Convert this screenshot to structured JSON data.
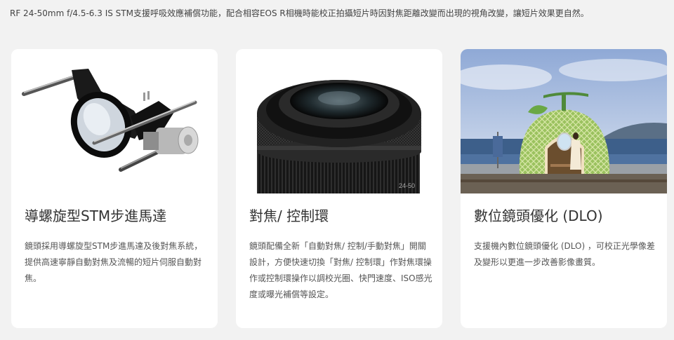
{
  "intro": "RF 24-50mm f/4.5-6.3 IS STM支援呼吸效應補償功能，配合相容EOS R相機時能校正拍攝短片時因對焦距離改變而出現的視角改變，讓短片效果更自然。",
  "cards": [
    {
      "title": "導螺旋型STM步進馬達",
      "body": "鏡頭採用導螺旋型STM步進馬達及後對焦系統，提供高速寧靜自動對焦及流暢的短片伺服自動對焦。"
    },
    {
      "title": "對焦/ 控制環",
      "body": "鏡頭配備全新「自動對焦/ 控制/手動對焦」開關設計，方便快速切換「對焦/ 控制環」作對焦環操作或控制環操作以調校光圈、快門速度、ISO感光度或曝光補償等設定。"
    },
    {
      "title": "數位鏡頭優化 (DLO)",
      "body": "支援機內數位鏡頭優化 (DLO) ，可校正光學像差及變形以更進一步改善影像畫質。"
    }
  ],
  "lens_marking": "24-50"
}
